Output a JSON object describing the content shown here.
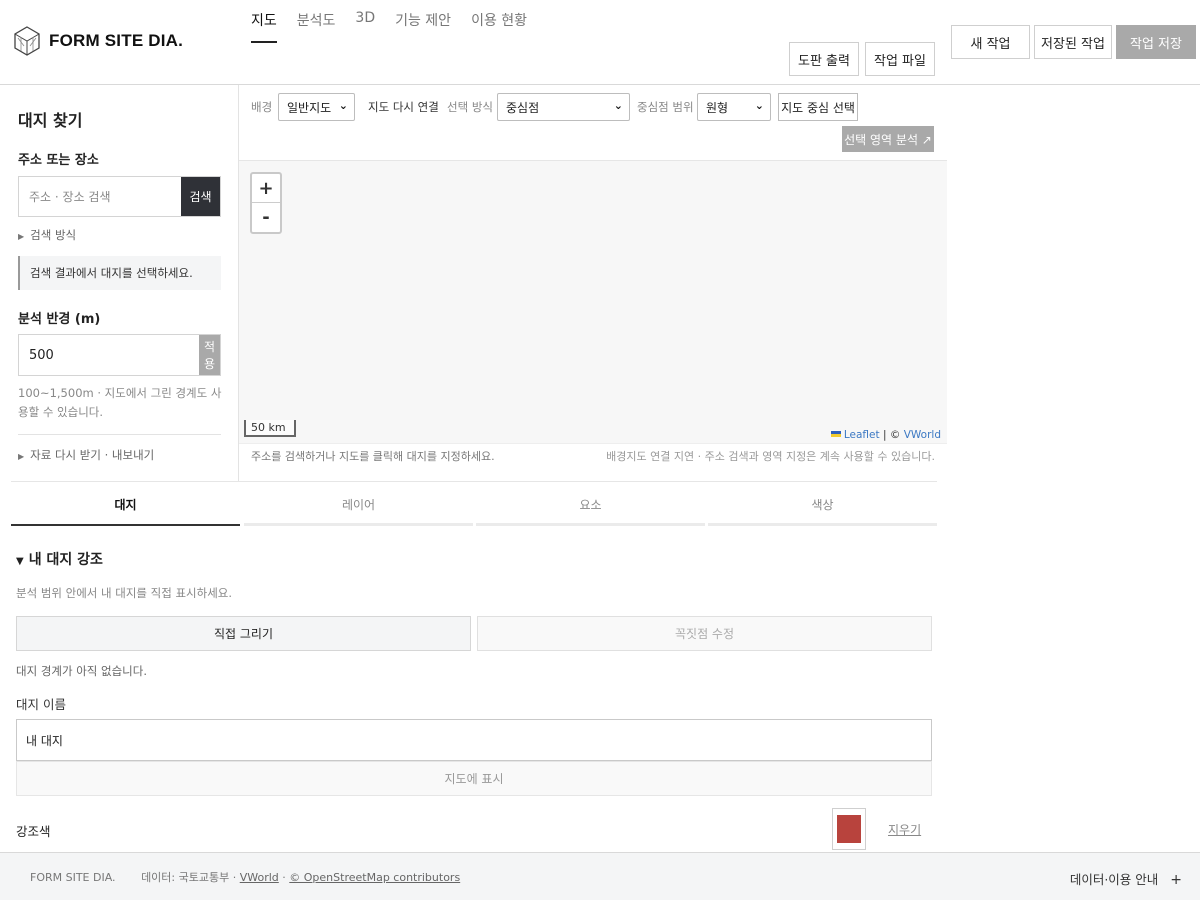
{
  "header": {
    "logo_text": "FORM SITE DIA.",
    "nav": [
      "지도",
      "분석도",
      "3D",
      "기능 제안",
      "이용 현황"
    ],
    "active_nav": "지도",
    "print_label": "도판 출력",
    "work_file_label": "작업 파일",
    "new_work_label": "새 작업",
    "saved_work_label": "저장된 작업",
    "save_work_label": "작업 저장"
  },
  "left_panel": {
    "title": "대지 찾기",
    "address_label": "주소 또는 장소",
    "search_placeholder": "주소 · 장소 검색",
    "search_button": "검색",
    "search_method": "검색 방식",
    "hint": "검색 결과에서 대지를 선택하세요.",
    "radius_label": "분석 반경 (m)",
    "radius_value": "500",
    "apply_button": "적용",
    "radius_help": "100~1,500m · 지도에서 그린 경계도 사용할 수 있습니다.",
    "reload_export": "자료 다시 받기 · 내보내기"
  },
  "toolbar": {
    "background_label": "배경",
    "background_value": "일반지도",
    "reconnect_link": "지도 다시 연결",
    "select_mode_label": "선택 방식",
    "select_mode_value": "중심점",
    "center_range_label": "중심점 범위",
    "center_range_value": "원형",
    "center_select_button": "지도 중심 선택",
    "analyze_button": "선택 영역 분석 ↗"
  },
  "map": {
    "zoom_in": "+",
    "zoom_out": "-",
    "scale": "50 km",
    "attribution_leaflet": "Leaflet",
    "attribution_sep": "| ©",
    "attribution_vworld": "VWorld",
    "footer_left": "주소를 검색하거나 지도를 클릭해 대지를 지정하세요.",
    "footer_right": "배경지도 연결 지연 · 주소 검색과 영역 지정은 계속 사용할 수 있습니다."
  },
  "tabs": [
    "대지",
    "레이어",
    "요소",
    "색상"
  ],
  "active_tab": "대지",
  "site_section": {
    "title": "내 대지 강조",
    "description": "분석 범위 안에서 내 대지를 직접 표시하세요.",
    "draw_button": "직접 그리기",
    "edit_vertex_button": "꼭짓점 수정",
    "no_boundary": "대지 경계가 아직 없습니다.",
    "name_label": "대지 이름",
    "name_value": "내 대지",
    "show_on_map_button": "지도에 표시",
    "accent_label": "강조색",
    "accent_color": "#b8433d",
    "clear_link": "지우기"
  },
  "footer": {
    "brand": "FORM SITE DIA.",
    "data_prefix": "데이터: 국토교통부 ·",
    "vworld_link": "VWorld",
    "sep": "·",
    "osm_link": "© OpenStreetMap contributors",
    "info_label": "데이터·이용 안내",
    "plus": "+"
  }
}
